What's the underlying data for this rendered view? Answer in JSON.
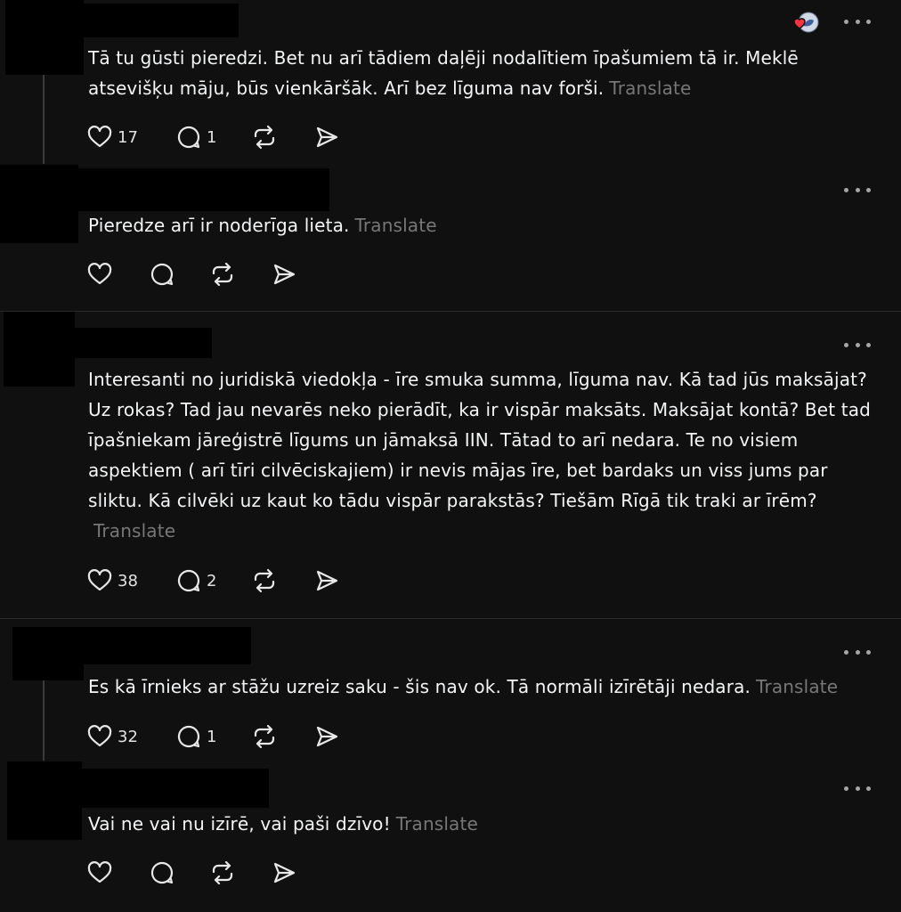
{
  "posts": [
    {
      "text": "Tā tu gūsti pieredzi. Bet nu arī tādiem daļēji nodalītiem īpašumiem tā ir. Meklē atsevišķu māju, būs vienkāršāk. Arī bez līguma nav forši.",
      "translate": "Translate",
      "likes": "17",
      "replies": "1"
    },
    {
      "text": "Pieredze arī ir noderīga lieta.",
      "translate": "Translate",
      "likes": "",
      "replies": ""
    },
    {
      "text": "Interesanti no juridiskā viedokļa - īre smuka summa, līguma nav. Kā tad jūs maksājat? Uz rokas? Tad jau nevarēs neko pierādīt, ka ir vispār maksāts. Maksājat kontā? Bet tad īpašniekam jāreģistrē līgums un jāmaksā IIN. Tātad to arī nedara. Te no visiem aspektiem ( arī tīri cilvēciskajiem) ir nevis mājas īre, bet bardaks un viss jums par sliktu. Kā cilvēki uz kaut ko tādu vispār parakstās? Tiešām Rīgā tik traki ar īrēm?",
      "translate": "Translate",
      "likes": "38",
      "replies": "2"
    },
    {
      "text": "Es kā īrnieks ar stāžu uzreiz saku - šis nav ok. Tā normāli izīrētāji nedara.",
      "translate": "Translate",
      "likes": "32",
      "replies": "1"
    },
    {
      "text": "Vai ne vai nu izīrē, vai paši dzīvo!",
      "translate": "Translate",
      "likes": "",
      "replies": ""
    }
  ],
  "icons": {
    "like": "heart-icon",
    "reply": "comment-icon",
    "repost": "repost-icon",
    "share": "send-icon",
    "more": "more-dots-icon"
  },
  "colors": {
    "background": "#101010",
    "text": "#f3f5f7",
    "muted": "#777777",
    "reaction_heart": "#ff3040"
  }
}
